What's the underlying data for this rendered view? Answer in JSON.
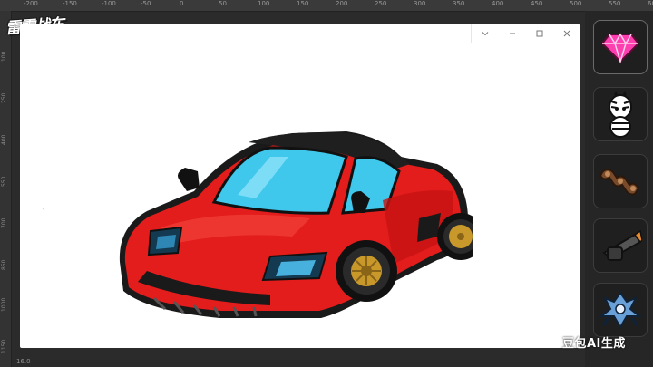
{
  "ruler": {
    "top_ticks": [
      "-200",
      "-150",
      "-100",
      "-50",
      "0",
      "50",
      "100",
      "150",
      "200",
      "250",
      "300",
      "350",
      "400",
      "450",
      "500",
      "550",
      "600"
    ],
    "left_ticks": [
      "100",
      "250",
      "400",
      "550",
      "700",
      "850",
      "1000",
      "1150"
    ]
  },
  "app": {
    "logo_text": "雷霆战车"
  },
  "window": {
    "controls": [
      "chevron-down-icon",
      "minimize-icon",
      "maximize-icon",
      "close-icon"
    ]
  },
  "canvas": {
    "subject_icon": "red-sports-car"
  },
  "sidebar": {
    "items": [
      {
        "icon": "pink-gem-icon"
      },
      {
        "icon": "zebra-character-icon"
      },
      {
        "icon": "chain-link-icon"
      },
      {
        "icon": "cannon-turret-icon"
      },
      {
        "icon": "mech-robot-icon"
      }
    ]
  },
  "footer": {
    "watermark": "豆包AI生成",
    "readout": "16.0"
  },
  "colors": {
    "car_red": "#e31c1c",
    "glass_blue": "#3fc7ec",
    "gold_rim": "#c8982b",
    "gem_pink": "#ff3fb0"
  }
}
